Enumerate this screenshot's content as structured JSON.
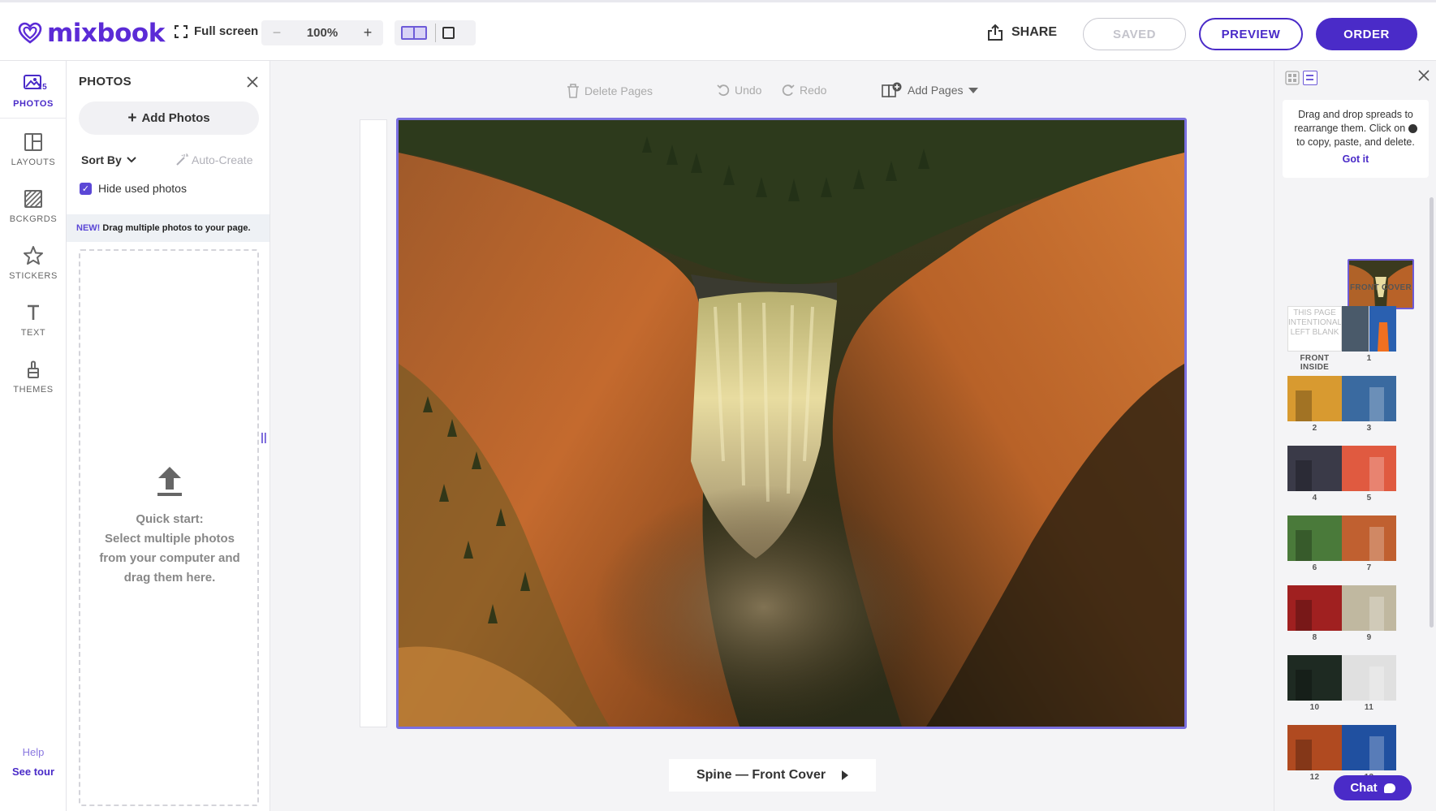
{
  "brand": {
    "name": "mixbook",
    "color": "#5b2bd6"
  },
  "topbar": {
    "fullscreen_label": "Full screen",
    "zoom": {
      "minus": "−",
      "value": "100%",
      "plus": "+"
    },
    "share_label": "SHARE",
    "saved_label": "SAVED",
    "preview_label": "PREVIEW",
    "order_label": "ORDER"
  },
  "nav": {
    "items": [
      {
        "label": "PHOTOS",
        "icon": "photo-icon",
        "badge": "25"
      },
      {
        "label": "LAYOUTS",
        "icon": "layouts-icon"
      },
      {
        "label": "BCKGRDS",
        "icon": "backgrounds-icon"
      },
      {
        "label": "STICKERS",
        "icon": "star-icon"
      },
      {
        "label": "TEXT",
        "icon": "text-icon"
      },
      {
        "label": "THEMES",
        "icon": "brush-icon"
      }
    ],
    "help_label": "Help",
    "tour_label": "See tour"
  },
  "photos_panel": {
    "title": "PHOTOS",
    "add_photos_label": "Add Photos",
    "sort_label": "Sort By",
    "autocreate_label": "Auto-Create",
    "hide_used_label": "Hide used photos",
    "hide_used_checked": true,
    "new_tag": "NEW!",
    "new_text": "Drag multiple photos to your page.",
    "quickstart": {
      "line1": "Quick start:",
      "line2": "Select multiple photos",
      "line3": "from your computer and",
      "line4": "drag them here."
    }
  },
  "canvas": {
    "delete_label": "Delete Pages",
    "undo_label": "Undo",
    "redo_label": "Redo",
    "add_pages_label": "Add Pages",
    "page_nav_label": "Spine — Front Cover"
  },
  "right_panel": {
    "tip_text": "Drag and drop spreads to rearrange them. Click on",
    "tip_text2": "to copy, paste, and delete.",
    "got_it_label": "Got it",
    "cover_label": "FRONT COVER",
    "front_inside_label": "FRONT INSIDE",
    "blank_page_text": "THIS PAGE INTENTIONALLY LEFT BLANK",
    "spread_labels": [
      [
        "1",
        ""
      ],
      [
        "2",
        "3"
      ],
      [
        "4",
        "5"
      ],
      [
        "6",
        "7"
      ],
      [
        "8",
        "9"
      ],
      [
        "10",
        "11"
      ],
      [
        "12",
        "13"
      ]
    ]
  },
  "chat_label": "Chat",
  "colors": {
    "accent": "#4a2bc8",
    "selection": "#7a6fe0",
    "canvas_bg": "#f4f4f6"
  }
}
